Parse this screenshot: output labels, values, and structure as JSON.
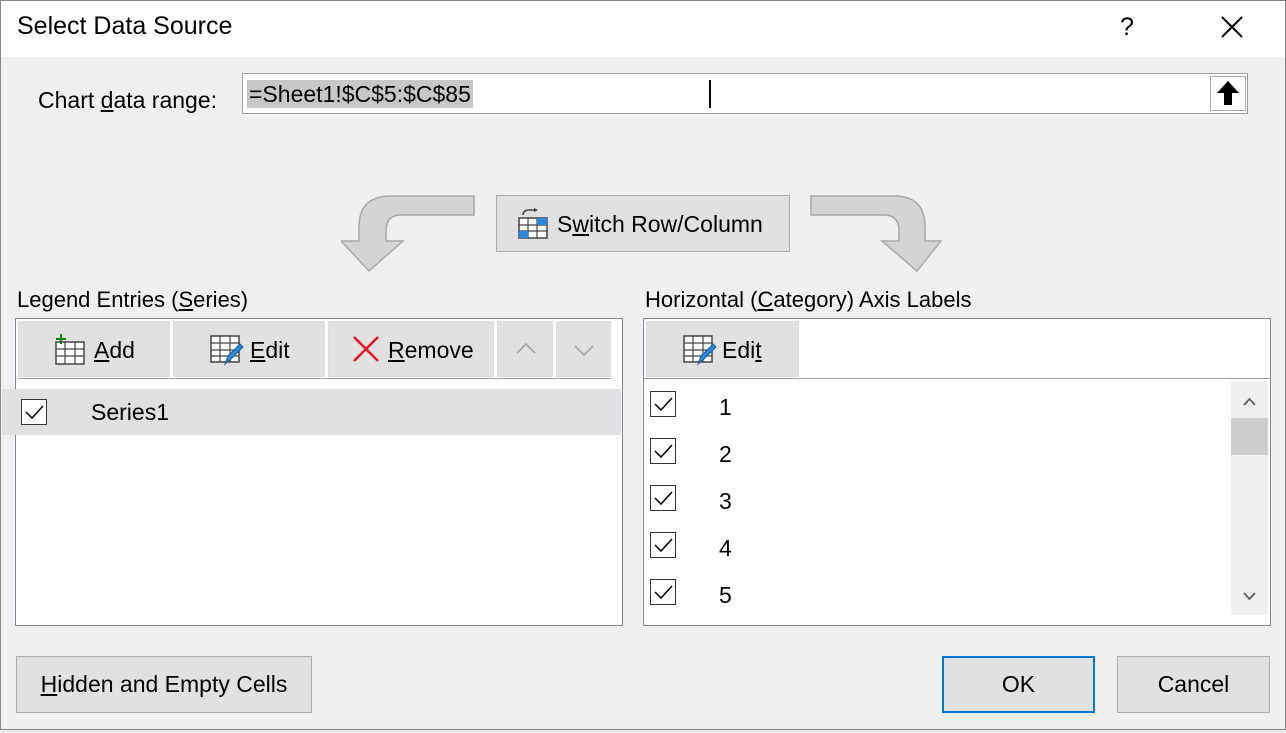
{
  "dialog": {
    "title": "Select Data Source",
    "help_label": "?"
  },
  "range": {
    "label_pre": "Chart ",
    "label_u": "d",
    "label_post": "ata range:",
    "value": "=Sheet1!$C$5:$C$85"
  },
  "switch": {
    "label_pre": "S",
    "label_u": "w",
    "label_post": "itch Row/Column"
  },
  "legend": {
    "label_pre": "Legend Entries (",
    "label_u": "S",
    "label_post": "eries)",
    "add_u": "A",
    "add_post": "dd",
    "edit_u": "E",
    "edit_post": "dit",
    "remove_u": "R",
    "remove_post": "emove",
    "series": [
      {
        "name": "Series1",
        "checked": true
      }
    ]
  },
  "axis": {
    "label_pre": "Horizontal (",
    "label_u": "C",
    "label_post": "ategory) Axis Labels",
    "edit_pre": "Edi",
    "edit_u": "t",
    "categories": [
      "1",
      "2",
      "3",
      "4",
      "5"
    ]
  },
  "footer": {
    "hidden_u": "H",
    "hidden_post": "idden and Empty Cells",
    "ok_label": "OK",
    "cancel_label": "Cancel"
  },
  "colors": {
    "accent": "#0078d7",
    "remove_red": "#e81123",
    "add_green": "#107c10"
  }
}
